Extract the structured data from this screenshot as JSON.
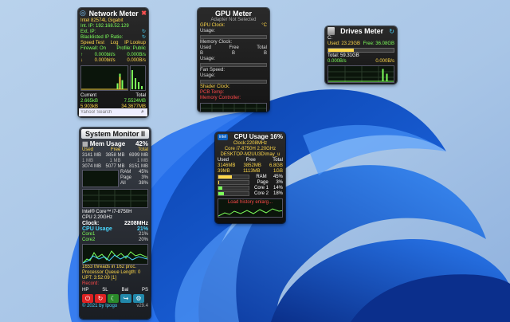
{
  "network_meter": {
    "title": "Network Meter",
    "adapter": "Intel 82574L Gigabit",
    "int_ip": "Int. IP: 192.168.52.129",
    "ext_ip": "Ext. IP:",
    "blacklisted": "Blacklisted IP Ratio:",
    "links": [
      "Speed Test",
      "Log",
      "IP Lookup"
    ],
    "firewall": "Firewall: On",
    "profile": "Profile: Public",
    "rate_up_1": "0.000bit/s",
    "rate_up_2": "0.000B/s",
    "rate_down_1": "0.000bit/s",
    "rate_down_2": "0.000B/s",
    "current_label": "Current",
    "total_label": "Total",
    "cur_up": "2.665kB",
    "cur_down": "5.903kB",
    "tot_up": "7.5524MB",
    "tot_down": "34.3677MB",
    "search_placeholder": "Yahoo! Search"
  },
  "gpu_meter": {
    "title": "GPU Meter",
    "subtitle": "Adapter Not Selected",
    "gpu_clock": "GPU Clock:",
    "gpu_clock_unit": "°C",
    "usage": "Usage:",
    "memory_clock": "Memory Clock:",
    "mem_cols": [
      "Used",
      "Free",
      "Total"
    ],
    "mem_vals": [
      "B",
      "B",
      "B"
    ],
    "usage2": "Usage:",
    "fan_speed": "Fan Speed:",
    "usage3": "Usage:",
    "shader_clock": "Shader Clock:",
    "pcb_temp": "PCB Temp:",
    "memory_controller": "Memory Controller:"
  },
  "drives_meter": {
    "title": "Drives Meter",
    "drive_letter": "C:",
    "used": "Used: 23.23GB",
    "free": "Free: 36.08GB",
    "total": "Total: 59.31GB",
    "read": "0.000B/s",
    "write": "0.000B/s"
  },
  "system_monitor": {
    "title": "System Monitor II",
    "mem_usage_label": "Mem Usage",
    "mem_usage_pct": "42%",
    "mem_cols": [
      "Used",
      "Free",
      "Total"
    ],
    "mem_rows": [
      [
        "3141 MB",
        "3858 MB",
        "6999 MB"
      ],
      [
        "3074 MB",
        "5077 MB",
        "8151 MB"
      ]
    ],
    "row2_extra": [
      "1 MB",
      "1 MB",
      "1 MB"
    ],
    "stats": [
      {
        "label": "RAM",
        "value": "45%"
      },
      {
        "label": "Page",
        "value": "3%"
      },
      {
        "label": "All",
        "value": "38%"
      }
    ],
    "cpu_name": "Intel® Core™ i7-8750H",
    "cpu_ghz": "CPU 2.20GHz",
    "clock_label": "Clock:",
    "clock_value": "2208MHz",
    "cpu_usage_label": "CPU Usage",
    "cpu_usage_pct": "21%",
    "cores": [
      {
        "label": "Core1",
        "value": "21%"
      },
      {
        "label": "Core2",
        "value": "20%"
      }
    ],
    "threads_line": "1653 threads in 162 proc.",
    "queue_line": "Processor Queue Length: 0",
    "uptime": "UPT: 3:52:09 [1]",
    "record": "Record:",
    "buttons": [
      "HP",
      "SL",
      "Bal",
      "PS"
    ],
    "footer": "© 2021 by Ipogo",
    "version": "v29.4"
  },
  "cpu_usage": {
    "title": "CPU Usage",
    "pct": "16%",
    "clock": "Clock:2208MHz",
    "cpu": "Core i7-8750H 2.20GHz",
    "host": "DESKTOP-M2UU3D\\may_u",
    "mem_cols": [
      "Used",
      "Free",
      "Total"
    ],
    "mem_rows": [
      [
        "3146MB",
        "3852MB",
        "6.8GB"
      ],
      [
        "39MB",
        "1113MB",
        "1GB"
      ]
    ],
    "stats": [
      {
        "label": "RAM",
        "value": "45%"
      },
      {
        "label": "Page",
        "value": "3%"
      },
      {
        "label": "Core 1",
        "value": "14%"
      },
      {
        "label": "Core 2",
        "value": "18%"
      }
    ],
    "footer": "Load history enlarg..."
  },
  "colors": {
    "accent_green": "#7dff5a",
    "accent_yellow": "#ffd84a",
    "wallpaper_blue": "#1d5bd8"
  }
}
